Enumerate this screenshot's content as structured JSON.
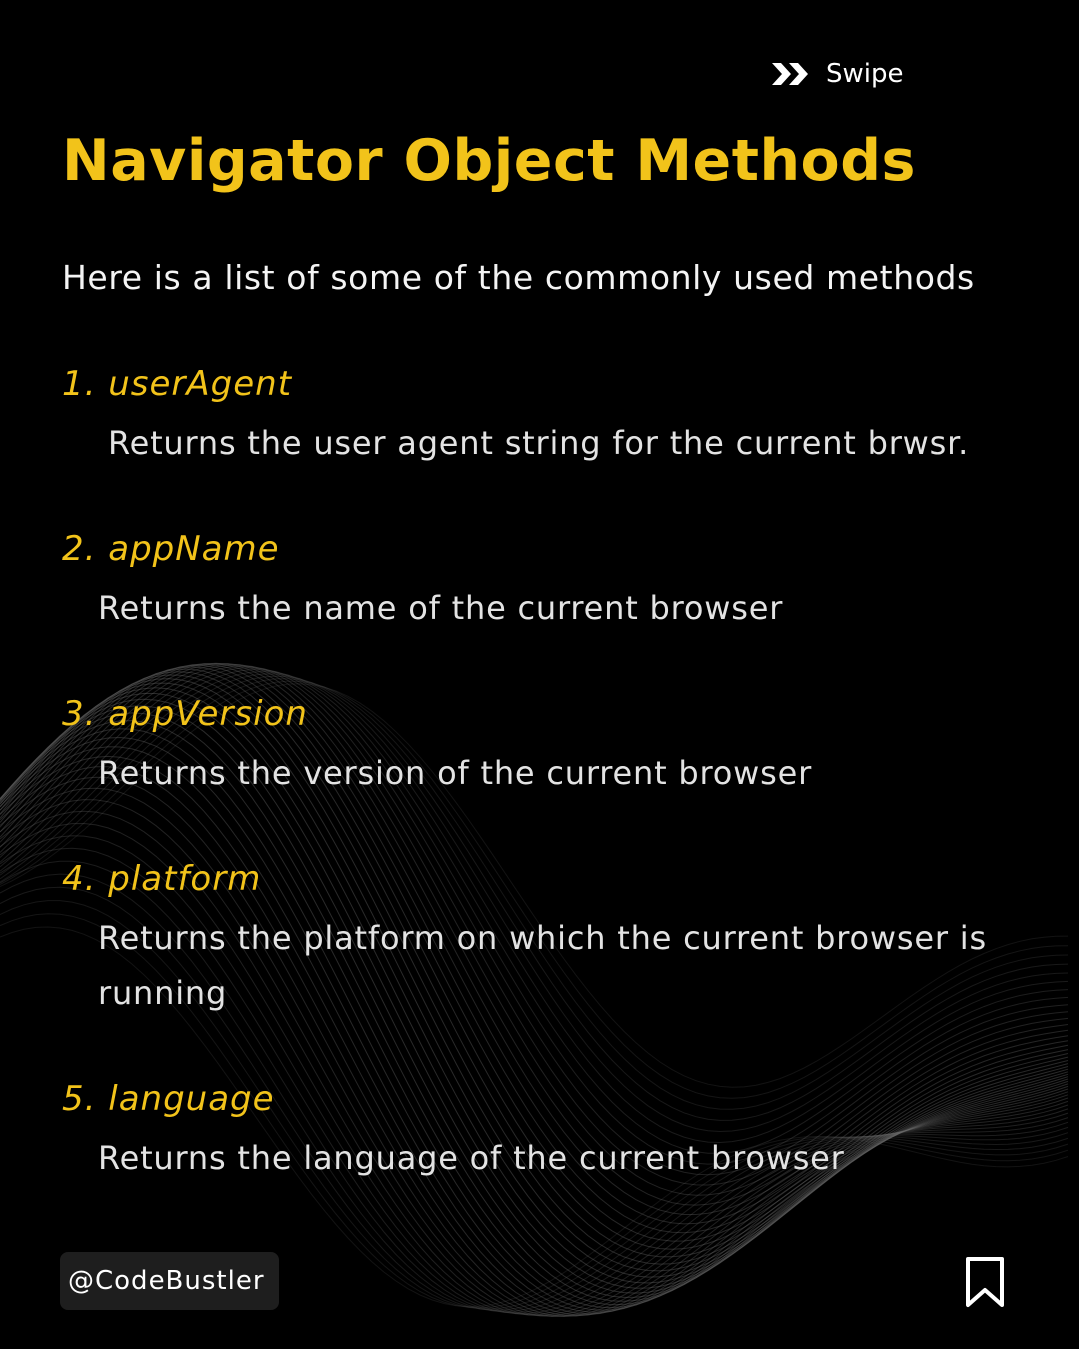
{
  "header": {
    "swipe_label": "Swipe",
    "swipe_icon": "double-chevron-right-icon"
  },
  "title": "Navigator Object Methods",
  "intro": "Here is a list of some of the commonly used methods",
  "methods": [
    {
      "title": "1. userAgent",
      "description": "Returns the user agent string for the current brwsr."
    },
    {
      "title": "2. appName",
      "description": "Returns the name of the current browser"
    },
    {
      "title": "3. appVersion",
      "description": "Returns the version of the current browser"
    },
    {
      "title": "4. platform",
      "description": "Returns the platform on which the current browser is running"
    },
    {
      "title": "5. language",
      "description": "Returns the language of the current browser"
    }
  ],
  "footer": {
    "handle": "@CodeBustler",
    "bookmark_icon": "bookmark-icon"
  },
  "colors": {
    "background": "#000000",
    "accent": "#f2c31a",
    "text": "#e3e3e3"
  }
}
